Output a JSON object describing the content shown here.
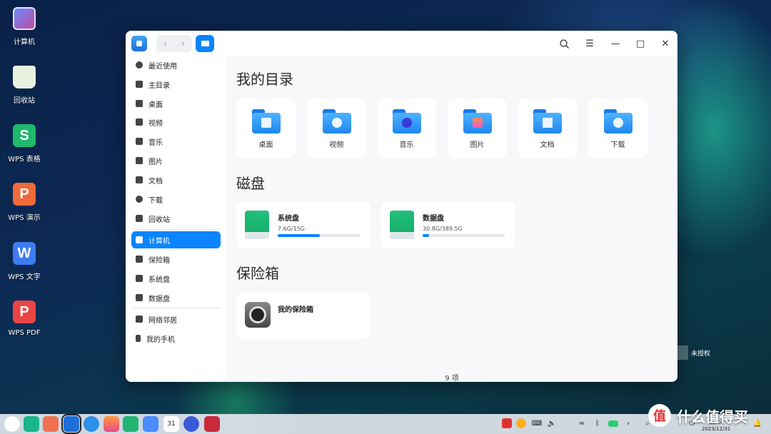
{
  "desktop": {
    "icons": [
      {
        "label": "计算机",
        "icon": "computer-icon"
      },
      {
        "label": "回收站",
        "icon": "trash-icon"
      },
      {
        "label": "WPS 表格",
        "icon": "wps-spreadsheet-icon",
        "glyph": "S",
        "color": "#1fb96c"
      },
      {
        "label": "WPS 演示",
        "icon": "wps-presentation-icon",
        "glyph": "P",
        "color": "#f06a3a"
      },
      {
        "label": "WPS 文字",
        "icon": "wps-writer-icon",
        "glyph": "W",
        "color": "#3c7cf0"
      },
      {
        "label": "WPS PDF",
        "icon": "wps-pdf-icon",
        "glyph": "P",
        "color": "#ea4545"
      }
    ],
    "license_notice": "未授权"
  },
  "window": {
    "sidebar": {
      "items": [
        {
          "label": "最近使用",
          "icon": "clock-icon"
        },
        {
          "label": "主目录",
          "icon": "home-icon"
        },
        {
          "label": "桌面",
          "icon": "desktop-icon"
        },
        {
          "label": "视频",
          "icon": "video-icon"
        },
        {
          "label": "音乐",
          "icon": "music-icon"
        },
        {
          "label": "图片",
          "icon": "picture-icon"
        },
        {
          "label": "文档",
          "icon": "document-icon"
        },
        {
          "label": "下载",
          "icon": "download-icon"
        },
        {
          "label": "回收站",
          "icon": "trash-icon"
        },
        {
          "label": "计算机",
          "icon": "computer-icon",
          "active": true
        },
        {
          "label": "保险箱",
          "icon": "vault-icon"
        },
        {
          "label": "系统盘",
          "icon": "disk-icon"
        },
        {
          "label": "数据盘",
          "icon": "disk-icon"
        },
        {
          "label": "网络邻居",
          "icon": "network-icon"
        },
        {
          "label": "我的手机",
          "icon": "phone-icon"
        }
      ]
    },
    "main": {
      "section_dirs": "我的目录",
      "dirs": [
        {
          "label": "桌面",
          "icon": "desktop-folder-icon"
        },
        {
          "label": "视频",
          "icon": "video-folder-icon"
        },
        {
          "label": "音乐",
          "icon": "music-folder-icon"
        },
        {
          "label": "图片",
          "icon": "picture-folder-icon"
        },
        {
          "label": "文档",
          "icon": "document-folder-icon"
        },
        {
          "label": "下载",
          "icon": "download-folder-icon"
        }
      ],
      "section_disks": "磁盘",
      "disks": [
        {
          "name": "系统盘",
          "size": "7.6G/15G",
          "used_fraction": 0.51
        },
        {
          "name": "数据盘",
          "size": "30.8G/389.5G",
          "used_fraction": 0.08
        }
      ],
      "section_vault": "保险箱",
      "vault": {
        "name": "我的保险箱"
      },
      "item_count": "9 项"
    }
  },
  "taskbar": {
    "date": "2023/12/31",
    "time": "11:54"
  },
  "watermark": {
    "text": "什么值得买",
    "logo": "值"
  }
}
